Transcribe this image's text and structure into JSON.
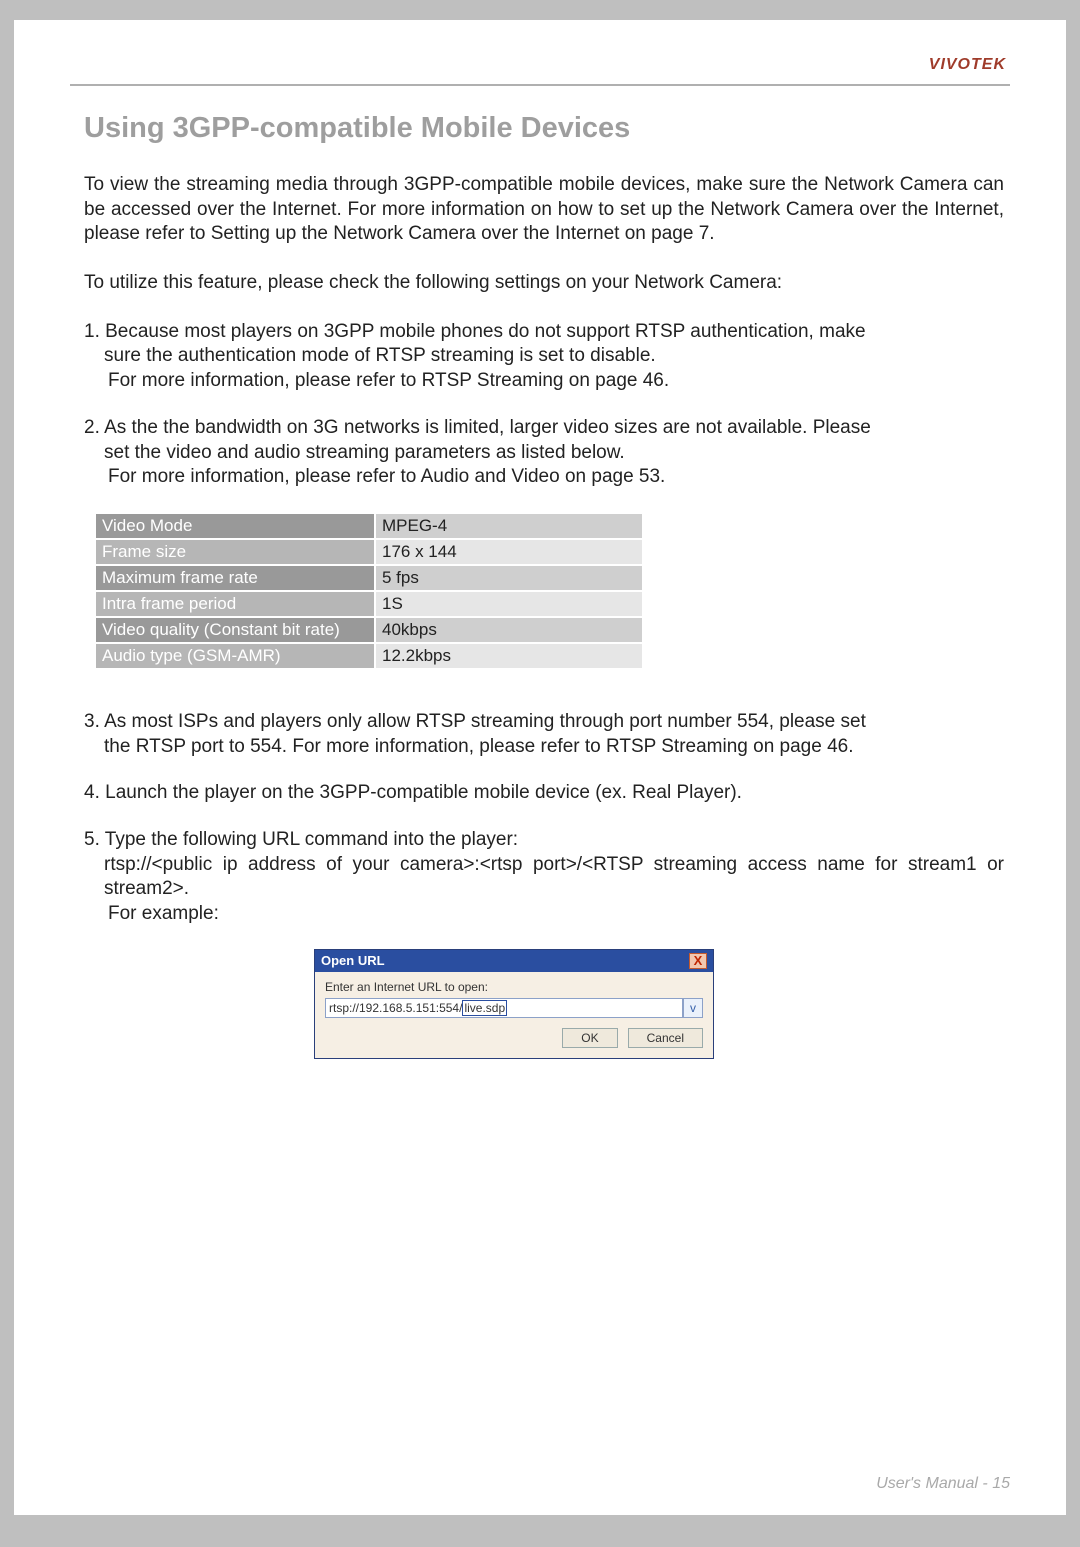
{
  "brand": "VIVOTEK",
  "section_title": "Using 3GPP-compatible Mobile Devices",
  "para_intro": "To view the streaming media through 3GPP-compatible mobile devices, make sure the Network Camera can be accessed over the Internet. For more information on how to set up the Network Camera over the Internet, please refer to Setting up the Network Camera over the Internet on page 7.",
  "para_utilize": "To utilize this feature, please check the following settings on your Network Camera:",
  "item1_lead": "1. Because most players on 3GPP mobile phones do not support RTSP authentication, make",
  "item1_cont": "sure the authentication mode of RTSP streaming is set to disable.",
  "item1_more": "For more information, please refer to RTSP Streaming on page 46.",
  "item2_lead": "2. As the the bandwidth on 3G networks is limited, larger video sizes are not available. Please",
  "item2_cont": "set the video and audio streaming parameters as listed below.",
  "item2_more": "For more information, please refer to Audio and Video on page 53.",
  "settings_rows": [
    {
      "label": "Video Mode",
      "value": "MPEG-4"
    },
    {
      "label": "Frame size",
      "value": "176 x 144"
    },
    {
      "label": "Maximum frame rate",
      "value": "5 fps"
    },
    {
      "label": "Intra frame period",
      "value": "1S"
    },
    {
      "label": "Video quality (Constant bit rate)",
      "value": "40kbps"
    },
    {
      "label": "Audio type (GSM-AMR)",
      "value": "12.2kbps"
    }
  ],
  "item3_lead": "3. As most ISPs and players only allow RTSP streaming through port number 554, please set",
  "item3_cont": "the RTSP port to 554. For more information, please refer to RTSP Streaming on page 46.",
  "item4_lead": "4. Launch the player on the 3GPP-compatible mobile device (ex. Real Player).",
  "item5_lead": "5. Type the following URL command into the player:",
  "item5_url": "rtsp://<public ip address of your camera>:<rtsp port>/<RTSP streaming access name for stream1 or stream2>.",
  "item5_eg": "For example:",
  "dialog": {
    "title": "Open URL",
    "close": "X",
    "label": "Enter an Internet URL to open:",
    "value_prefix": "rtsp://192.168.5.151:554/",
    "value_cursor": "live.sdp",
    "drop_glyph": "v",
    "ok": "OK",
    "cancel": "Cancel"
  },
  "footer": "User's Manual - 15"
}
